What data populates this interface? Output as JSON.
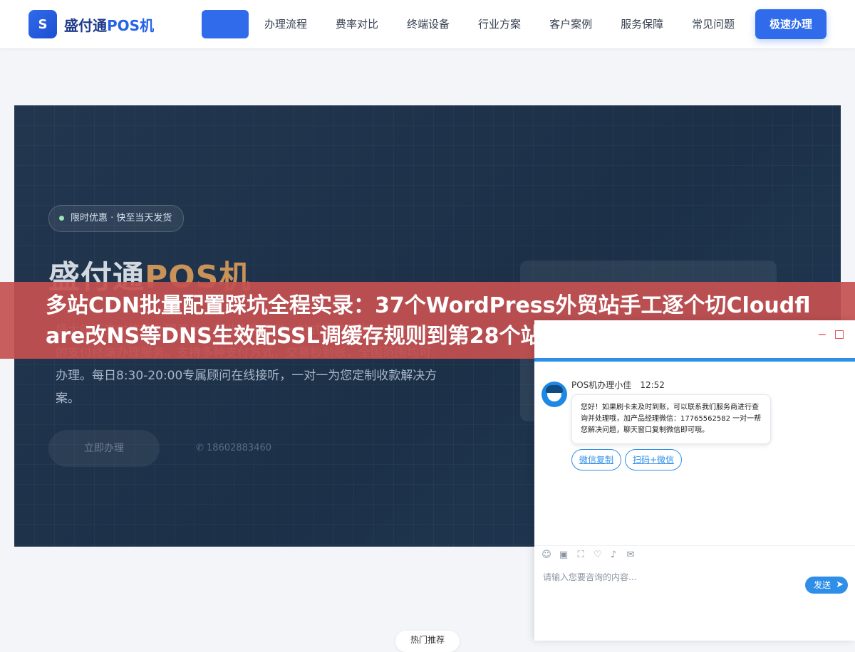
{
  "header": {
    "logo_letter": "S",
    "logo_main": "盛付通",
    "logo_accent": "POS机",
    "nav": [
      {
        "label": ""
      },
      {
        "label": "办理流程"
      },
      {
        "label": "费率对比"
      },
      {
        "label": "终端设备"
      },
      {
        "label": "行业方案"
      },
      {
        "label": "客户案例"
      },
      {
        "label": "服务保障"
      },
      {
        "label": "常见问题"
      }
    ],
    "cta_label": "极速办理"
  },
  "hero": {
    "badge": "限时优惠 · 快至当天发货",
    "title_main": "盛付通",
    "title_accent": "POS机",
    "desc": "盛大旗下支付终端办理平台，专业为您提供一站式收款服务，安全高效的支付终端办理服务。支持多种支付方式，交易秒到账，全国范围均可办理。每日8:30-20:00专属顾问在线接听，一对一为您定制收款解决方案。",
    "primary_button": "立即办理",
    "phone": "18602883460"
  },
  "banner": {
    "text": "多站CDN批量配置踩坑全程实录：37个WordPress外贸站手工逐个切Cloudflare改NS等DNS生效配SSL调缓存规则到第28个站漏配Always U"
  },
  "chat": {
    "agent_name": "POS机办理小佳",
    "time": "12:52",
    "message": "您好！如果刷卡未及时到账，可以联系我们服务商进行查询并处理哦，加产品经理微信：17765562582 一对一帮您解决问题，聊天窗口复制微信即可哦。",
    "quick_copy": "微信复制",
    "quick_scan": "扫码+微信",
    "input_placeholder": "请输入您要咨询的内容...",
    "send_label": "发送"
  },
  "bottom": {
    "pill": "热门推荐"
  },
  "colors": {
    "brand": "#2f6bea",
    "banner": "#c65050",
    "chat_accent": "#2f8fe8"
  }
}
